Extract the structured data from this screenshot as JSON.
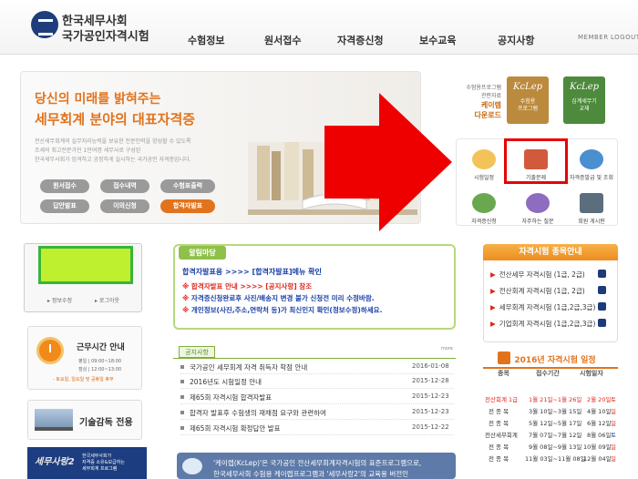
{
  "header": {
    "org_line1": "한국세무사회",
    "org_line2": "국가공인자격시험",
    "nav": [
      "수험정보",
      "원서접수",
      "자격증신청",
      "보수교육",
      "공지사항"
    ],
    "util": [
      "MEMBER",
      "LOGOUT"
    ]
  },
  "banner": {
    "line1": "당신의 미래를 밝혀주는",
    "line2": "세무회계 분야의 대표자격증",
    "desc": [
      "전산세무회계의 실무처리능력을 보유한 전문인력을 양성할 수 있도록",
      "조세의 최고전문가인 1만여명 세무사로 구성된",
      "한국세무사회가 엄격하고 공정하게 실시하는 국가공인 자격증입니다."
    ],
    "buttons": [
      "원서접수",
      "접수내역",
      "수험표출력",
      "답안발표",
      "이의신청",
      "합격자발표"
    ],
    "highlight_button": "합격자발표"
  },
  "download": {
    "caption": [
      "수험용프로그램",
      "관련자료"
    ],
    "title": [
      "케이렙",
      "다운로드"
    ],
    "book1": {
      "logo": "KcLep",
      "label": "수험용\n프로그램"
    },
    "book2": {
      "logo": "KcLep",
      "label": "심계세무기\n교재"
    }
  },
  "quick_menu": [
    "시험일정",
    "기출문제",
    "자격증발급 및 조회",
    "자격증신청",
    "자주하는 질문",
    "회원 게시판"
  ],
  "login_box": {
    "links": [
      "정보수정",
      "로그아웃"
    ]
  },
  "hours": {
    "title": "근무시간 안내",
    "lines": [
      "평일 | 09:00~18:00",
      "점심 | 12:00~13:00"
    ],
    "note": "- 토요일, 일요일 및 공휴일 휴무"
  },
  "tech": {
    "label": "기술감독 전용"
  },
  "promo": {
    "brand": "세무사랑2",
    "lines": [
      "한국세무사회가",
      "자격증 소유&보급하는",
      "세무회계 프로그램"
    ]
  },
  "alimmadang": {
    "tab": "알림마당",
    "headline": "합격자발표용 >>>> [합격자발표]메뉴 확인",
    "lines": [
      {
        "mark": "※",
        "text": "합격자발표 안내 >>>> [공지사항] 참조"
      },
      {
        "mark": "※",
        "text": "자격증신청완료후 사진/배송지 변경 불가 신청전 미리 수정바람."
      },
      {
        "mark": "※",
        "text": "개인정보(사진,주소,연락처 등)가 최신인지 확인(정보수정)하세요."
      }
    ]
  },
  "notices": {
    "tab": "공지사항",
    "more": "more",
    "items": [
      {
        "title": "국가공인 세무회계 자격 취득자 학점 안내",
        "date": "2016-01-08"
      },
      {
        "title": "2016년도 시험일정 안내",
        "date": "2015-12-28"
      },
      {
        "title": "제65회 자격시험 합격자발표",
        "date": "2015-12-23"
      },
      {
        "title": "합격자 발표후 수험생의 재채점 요구와 관련하여",
        "date": "2015-12-23"
      },
      {
        "title": "제65회 자격시험 확정답안 발표",
        "date": "2015-12-22"
      }
    ]
  },
  "kclep_strip": {
    "lines": [
      "'케이렙(KcLep)'은 국가공인 전산세무회계자격시험의 표준프로그램으로,",
      "한국세무사회 수험용 케이렙프로그램과 '세무사랑2'의 교육용 버전인"
    ]
  },
  "exam_kinds": {
    "title": "자격시험 종목안내",
    "items": [
      "전산세무 자격시험 (1급, 2급)",
      "전산회계 자격시험 (1급, 2급)",
      "세무회계 자격시험 (1급,2급,3급)",
      "기업회계 자격시험 (1급,2급,3급)"
    ]
  },
  "schedule": {
    "title": "2016년 자격시험 일정",
    "headers": [
      "종목",
      "접수기간",
      "시험일자"
    ],
    "rows": [
      {
        "kind": "전산회계 1급",
        "period": "1월 21일~1월 26일",
        "date": "2월 20일",
        "day": "토"
      },
      {
        "kind": "전 종 목",
        "period": "3월 10일~3월 15일",
        "date": "4월 10일",
        "day": "일"
      },
      {
        "kind": "전 종 목",
        "period": "5월 12일~5월 17일",
        "date": "6월 12일",
        "day": "일"
      },
      {
        "kind": "전산세무회계",
        "period": "7월 07일~7월 12일",
        "date": "8월 06일",
        "day": "토"
      },
      {
        "kind": "전 종 목",
        "period": "9월 08일~9월 13일",
        "date": "10월 09일",
        "day": "일"
      },
      {
        "kind": "전 종 목",
        "period": "11월 03일~11월 08일",
        "date": "12월 04일",
        "day": "일"
      }
    ]
  },
  "colors": {
    "accent_orange": "#e2731c",
    "nav_blue": "#1f3d7a",
    "highlight_red": "#e80000",
    "notice_green": "#8fc04a"
  }
}
